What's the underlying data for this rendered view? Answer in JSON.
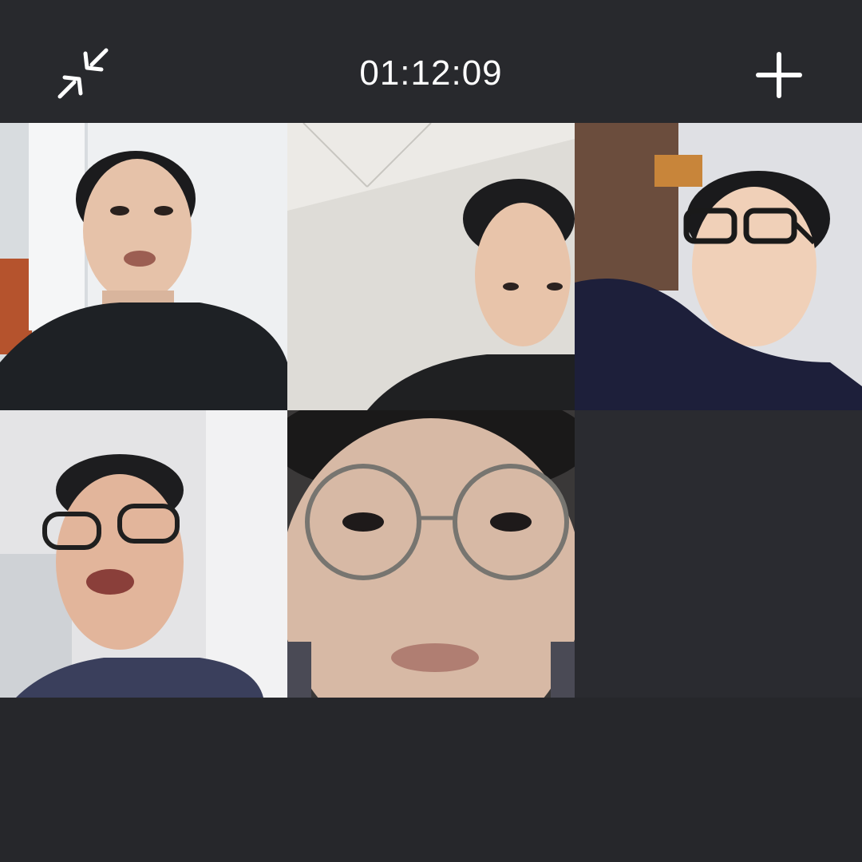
{
  "call": {
    "timer": "01:12:09",
    "minimize_icon": "minimize-arrows-icon",
    "add_icon": "plus-icon"
  },
  "participants": [
    {
      "id": "p1",
      "shirt_color": "#1e2125",
      "wall_color": "#e9ecef"
    },
    {
      "id": "p2",
      "shirt_color": "#1f2022",
      "wall_color": "#dcdad5"
    },
    {
      "id": "p3",
      "shirt_color": "#1d1f3a",
      "wall_color": "#dfe0e4"
    },
    {
      "id": "p4",
      "shirt_color": "#3a3f5c",
      "wall_color": "#e6e6e8"
    },
    {
      "id": "p5",
      "shirt_color": "#4a4a55",
      "wall_color": "#3a3838"
    }
  ],
  "colors": {
    "background": "#26272b",
    "text": "#ffffff"
  }
}
